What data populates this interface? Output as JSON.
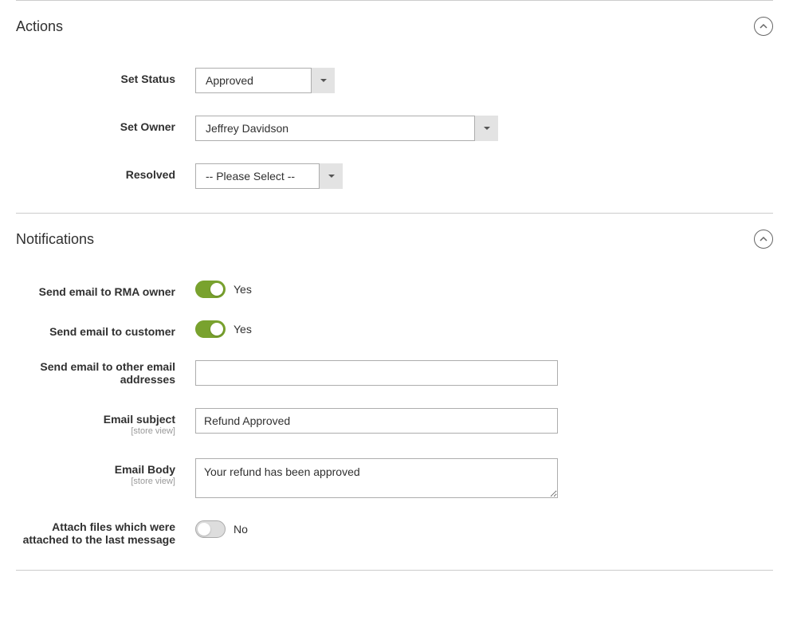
{
  "sections": {
    "actions": {
      "title": "Actions",
      "fields": {
        "set_status": {
          "label": "Set Status",
          "value": "Approved"
        },
        "set_owner": {
          "label": "Set Owner",
          "value": "Jeffrey Davidson"
        },
        "resolved": {
          "label": "Resolved",
          "value": "-- Please Select --"
        }
      }
    },
    "notifications": {
      "title": "Notifications",
      "fields": {
        "send_owner": {
          "label": "Send email to RMA owner",
          "value_label": "Yes"
        },
        "send_customer": {
          "label": "Send email to customer",
          "value_label": "Yes"
        },
        "send_other": {
          "label": "Send email to other email addresses",
          "value": ""
        },
        "subject": {
          "label": "Email subject",
          "scope": "[store view]",
          "value": "Refund Approved"
        },
        "body": {
          "label": "Email Body",
          "scope": "[store view]",
          "value": "Your refund has been approved"
        },
        "attach": {
          "label": "Attach files which were attached to the last message",
          "value_label": "No"
        }
      }
    }
  }
}
